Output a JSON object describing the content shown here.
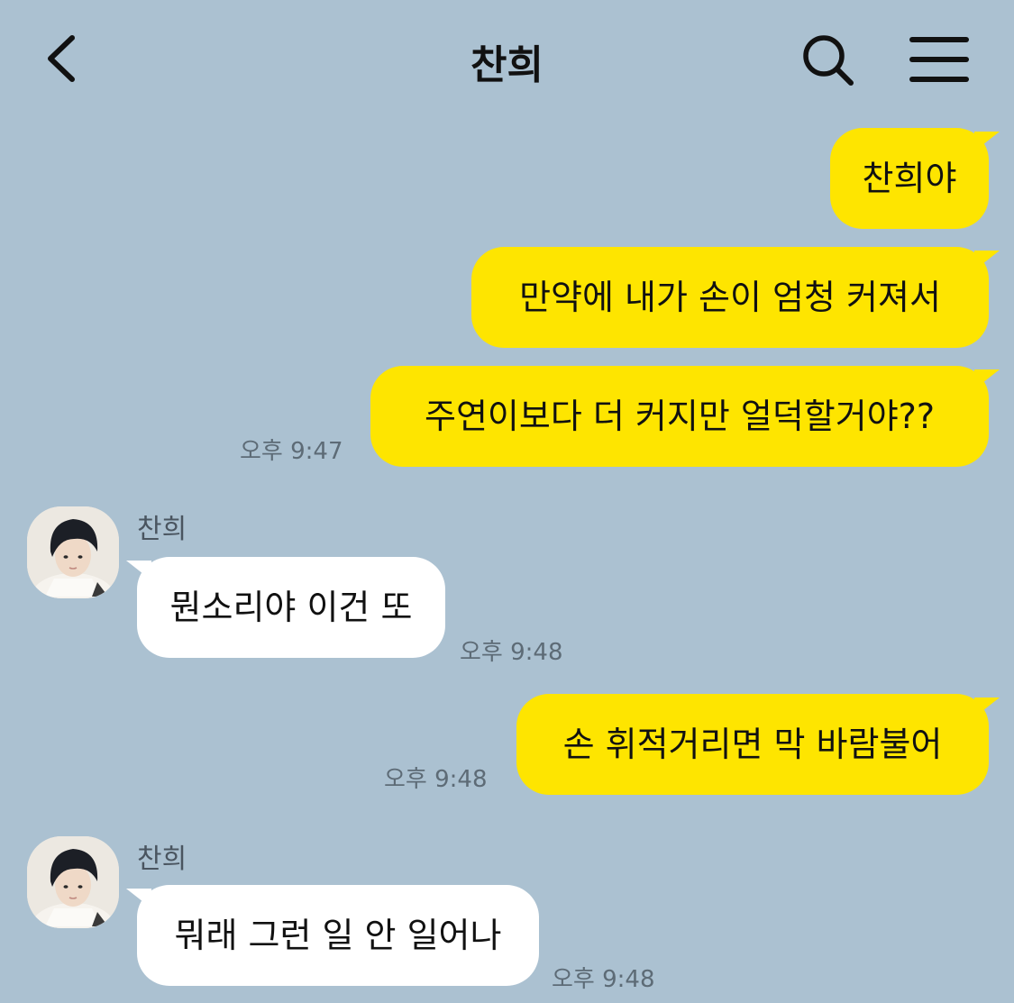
{
  "header": {
    "title": "찬희",
    "back_icon": "chevron-left-icon",
    "search_icon": "search-icon",
    "menu_icon": "hamburger-menu-icon"
  },
  "colors": {
    "background": "#abc1d1",
    "my_bubble": "#fee500",
    "friend_bubble": "#ffffff"
  },
  "messages": [
    {
      "sender": "me",
      "text": "찬희야"
    },
    {
      "sender": "me",
      "text": "만약에 내가 손이 엄청 커져서"
    },
    {
      "sender": "me",
      "text": "주연이보다 더 커지만 얼덕할거야??",
      "time": "오후 9:47"
    },
    {
      "sender": "friend",
      "name": "찬희",
      "text": "뭔소리야 이건 또",
      "time": "오후 9:48"
    },
    {
      "sender": "me",
      "text": "손 휘적거리면 막 바람불어",
      "time": "오후 9:48"
    },
    {
      "sender": "friend",
      "name": "찬희",
      "text": "뭐래 그런 일 안 일어나",
      "time": "오후 9:48"
    }
  ]
}
